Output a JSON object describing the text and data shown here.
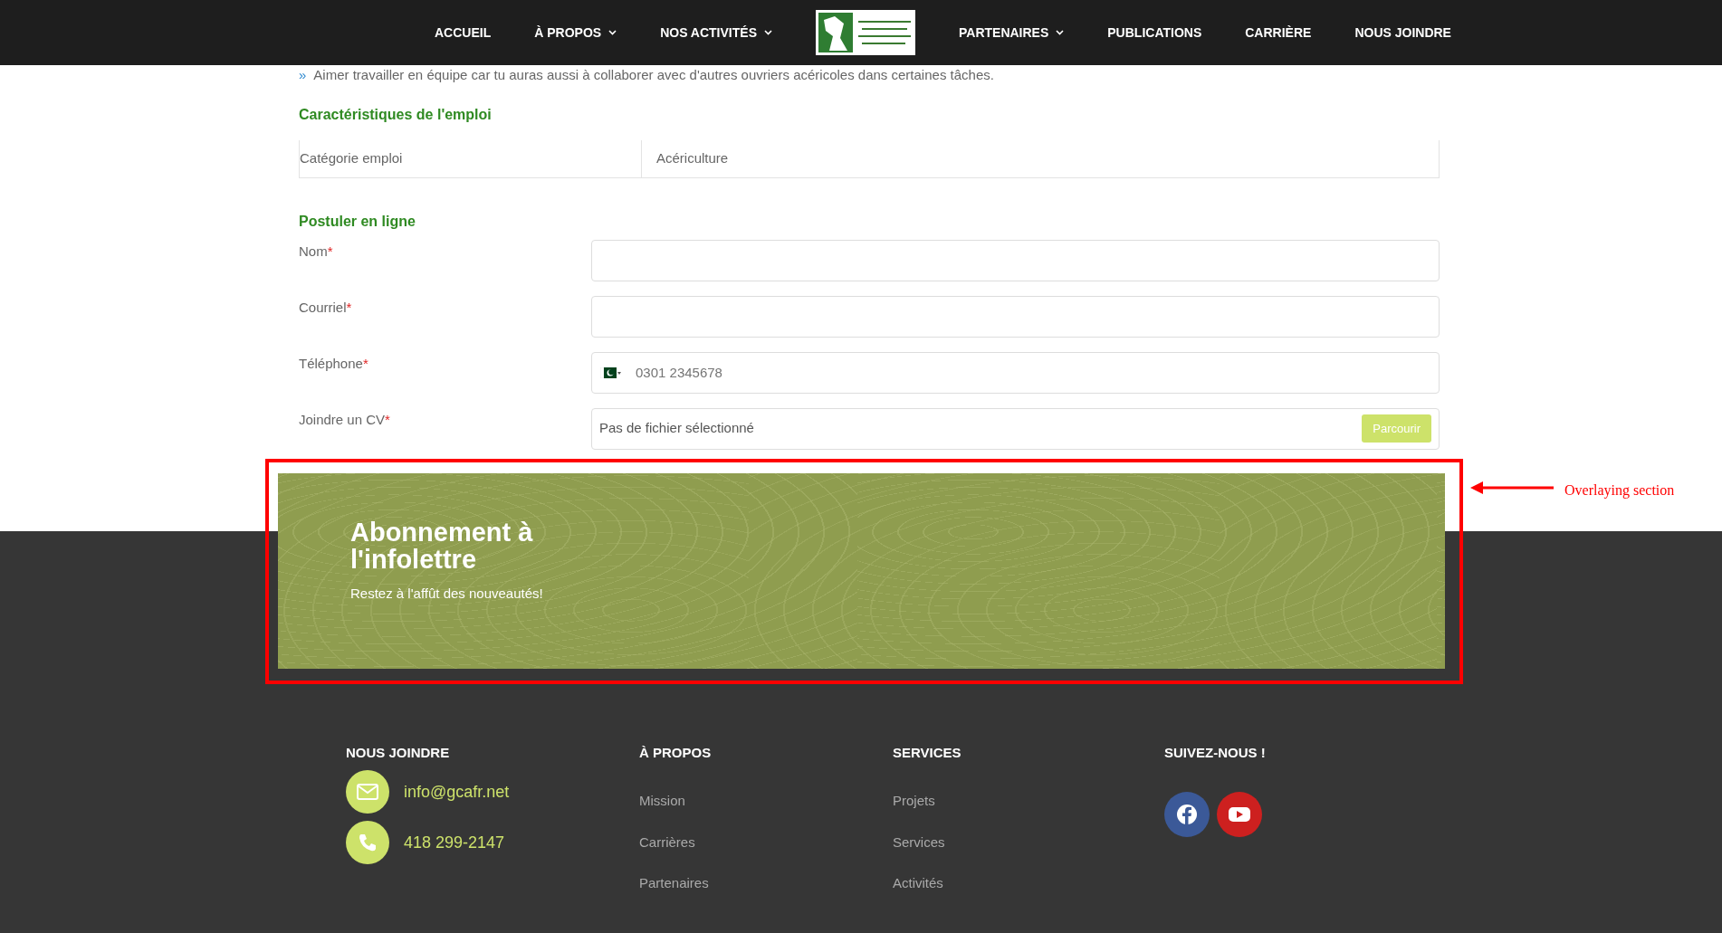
{
  "navbar": {
    "left_items": [
      {
        "label": "ACCUEIL",
        "dropdown": false
      },
      {
        "label": "À PROPOS",
        "dropdown": true
      },
      {
        "label": "NOS ACTIVITÉS",
        "dropdown": true
      }
    ],
    "right_items": [
      {
        "label": "PARTENAIRES",
        "dropdown": true
      },
      {
        "label": "PUBLICATIONS",
        "dropdown": false
      },
      {
        "label": "CARRIÈRE",
        "dropdown": false
      },
      {
        "label": "NOUS JOINDRE",
        "dropdown": false
      }
    ]
  },
  "requirements": [
    {
      "bullet": "»",
      "text": "Aimer travailler en équipe car tu auras aussi à collaborer avec d'autres ouvriers acéricoles dans certaines tâches."
    }
  ],
  "characteristics": {
    "title": "Caractéristiques de l'emploi",
    "rows": [
      {
        "label": "Catégorie emploi",
        "value": "Acériculture"
      }
    ]
  },
  "application_form": {
    "title": "Postuler en ligne",
    "fields": [
      {
        "kind": "text",
        "label": "Nom",
        "required_mark": "*"
      },
      {
        "kind": "text",
        "label": "Courriel",
        "required_mark": "*"
      },
      {
        "kind": "phone",
        "label": "Téléphone",
        "required_mark": "*",
        "placeholder": "0301 2345678"
      },
      {
        "kind": "file",
        "label": "Joindre un CV",
        "required_mark": "*",
        "value": "Pas de fichier sélectionné",
        "button": "Parcourir"
      }
    ]
  },
  "newsletter": {
    "title": "Abonnement à l'infolettre",
    "subtitle": "Restez à l'affût des nouveautés!"
  },
  "annotation": {
    "label": "Overlaying section"
  },
  "footer": {
    "columns": [
      {
        "kind": "contact",
        "heading": "NOUS JOINDRE",
        "items": [
          {
            "text": "info@gcafr.net"
          },
          {
            "text": "418 299-2147"
          }
        ]
      },
      {
        "kind": "links",
        "heading": "À PROPOS",
        "items": [
          {
            "text": "Mission"
          },
          {
            "text": "Carrières"
          },
          {
            "text": "Partenaires"
          }
        ]
      },
      {
        "kind": "links",
        "heading": "SERVICES",
        "items": [
          {
            "text": "Projets"
          },
          {
            "text": "Services"
          },
          {
            "text": "Activités"
          }
        ]
      },
      {
        "kind": "social",
        "heading": "SUIVEZ-NOUS !",
        "items": [
          {
            "color": "#3b5998"
          },
          {
            "color": "#cd201f"
          }
        ]
      }
    ]
  }
}
